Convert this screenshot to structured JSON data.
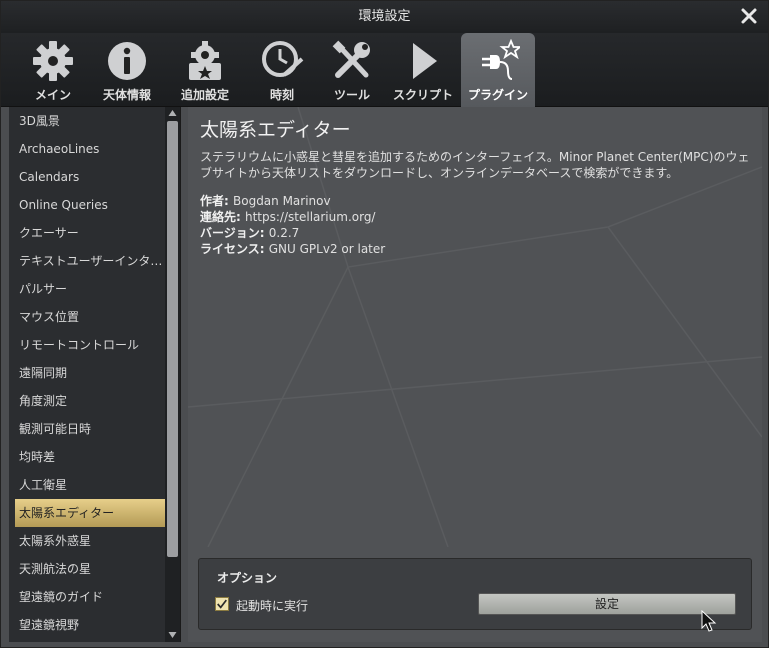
{
  "window": {
    "title": "環境設定"
  },
  "tabs": [
    {
      "label": "メイン",
      "icon": "gear-icon"
    },
    {
      "label": "天体情報",
      "icon": "info-icon"
    },
    {
      "label": "追加設定",
      "icon": "extras-gear-icon"
    },
    {
      "label": "時刻",
      "icon": "clock-icon"
    },
    {
      "label": "ツール",
      "icon": "tools-icon"
    },
    {
      "label": "スクリプト",
      "icon": "play-icon"
    },
    {
      "label": "プラグイン",
      "icon": "plugin-icon"
    }
  ],
  "active_tab": "プラグイン",
  "plugins": [
    "3D風景",
    "ArchaeoLines",
    "Calendars",
    "Online Queries",
    "クエーサー",
    "テキストユーザーインター…",
    "パルサー",
    "マウス位置",
    "リモートコントロール",
    "遠隔同期",
    "角度測定",
    "観測可能日時",
    "均時差",
    "人工衛星",
    "太陽系エディター",
    "太陽系外惑星",
    "天測航法の星",
    "望遠鏡のガイド",
    "望遠鏡視野"
  ],
  "selected_plugin": "太陽系エディター",
  "detail": {
    "title": "太陽系エディター",
    "description": "ステラリウムに小惑星と彗星を追加するためのインターフェイス。Minor Planet Center(MPC)のウェブサイトから天体リストをダウンロードし、オンラインデータベースで検索ができます。",
    "author_label": "作者",
    "author": "Bogdan Marinov",
    "contact_label": "連絡先",
    "contact": "https://stellarium.org/",
    "version_label": "バージョン",
    "version": "0.2.7",
    "license_label": "ライセンス",
    "license": "GNU GPLv2 or later"
  },
  "options": {
    "label": "オプション",
    "load_at_startup_label": "起動時に実行",
    "load_at_startup": true,
    "configure_label": "設定"
  },
  "colors": {
    "selected_item": "#d9c27a",
    "window_bg": "#4b4d50"
  }
}
